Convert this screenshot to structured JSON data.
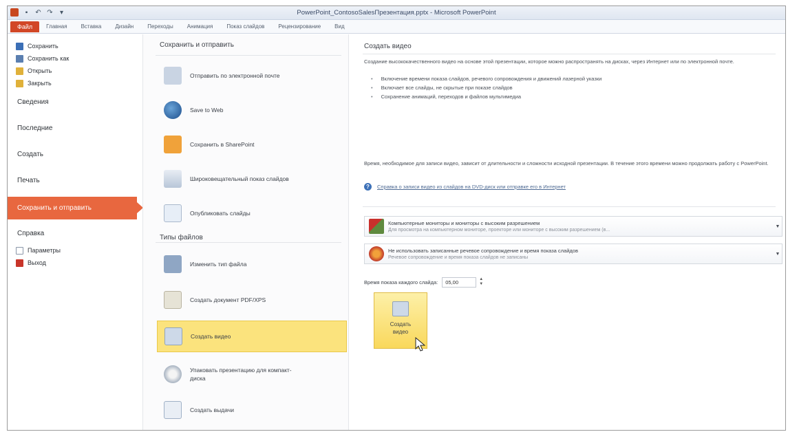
{
  "window": {
    "title": "PowerPoint_ContosoSalesПрезентация.pptx - Microsoft PowerPoint"
  },
  "ribbon": {
    "file_tab": "Файл",
    "tabs": [
      "Главная",
      "Вставка",
      "Дизайн",
      "Переходы",
      "Анимация",
      "Показ слайдов",
      "Рецензирование",
      "Вид"
    ]
  },
  "nav": {
    "save": "Сохранить",
    "save_as": "Сохранить как",
    "open": "Открыть",
    "close": "Закрыть",
    "info": "Сведения",
    "recent": "Последние",
    "new": "Создать",
    "print": "Печать",
    "save_send": "Сохранить и отправить",
    "help": "Справка",
    "options": "Параметры",
    "exit": "Выход"
  },
  "middle": {
    "heading_save_send": "Сохранить и отправить",
    "items_send": [
      "Отправить по электронной почте",
      "Save to Web",
      "Сохранить в SharePoint",
      "Широковещательный показ слайдов",
      "Опубликовать слайды"
    ],
    "heading_file_types": "Типы файлов",
    "items_types": [
      "Изменить тип файла",
      "Создать документ PDF/XPS",
      "Создать видео",
      "Упаковать презентацию для компакт-диска",
      "Создать выдачи"
    ]
  },
  "right": {
    "title": "Создать видео",
    "description": "Создание высококачественного видео на основе этой презентации, которое можно распространять на дисках, через Интернет или по электронной почте.",
    "bullets": [
      "Включение времени показа слайдов, речевого сопровождения и движений лазерной указки",
      "Включает все слайды, не скрытые при показе слайдов",
      "Сохранение анимаций, переходов и файлов мультимедиа"
    ],
    "time_note": "Время, необходимое для записи видео, зависит от длительности и сложности исходной презентации. В течение этого времени можно продолжать работу с PowerPoint.",
    "help_link": "Справка о записи видео из слайдов на DVD-диск или отправке его в Интернет",
    "dropdown_quality": {
      "main": "Компьютерные мониторы и мониторы с высоким разрешением",
      "sub": "Для просмотра на компьютерном мониторе, проекторе или мониторе с высоким разрешением (в..."
    },
    "dropdown_narration": {
      "main": "Не использовать записанные речевое сопровождение и время показа слайдов",
      "sub": "Речевое сопровождение и время показа слайдов не записаны"
    },
    "seconds_label": "Время показа каждого слайда:",
    "seconds_value": "05,00",
    "create_button": "Создать видео"
  }
}
